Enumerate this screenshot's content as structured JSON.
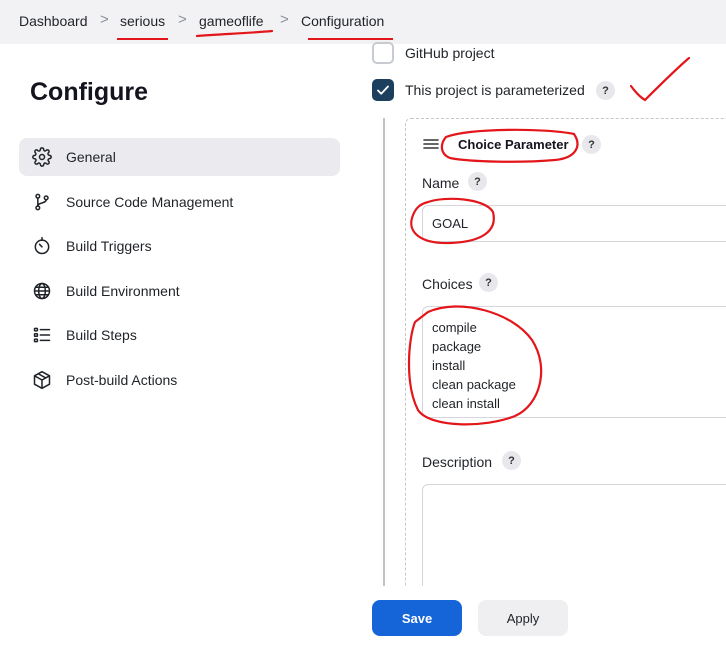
{
  "breadcrumb": {
    "items": [
      "Dashboard",
      "serious",
      "gameoflife",
      "Configuration"
    ],
    "separator": ">"
  },
  "page": {
    "title": "Configure"
  },
  "sidebar": {
    "items": [
      {
        "label": "General",
        "icon": "gear-icon",
        "active": true
      },
      {
        "label": "Source Code Management",
        "icon": "branch-icon"
      },
      {
        "label": "Build Triggers",
        "icon": "timer-icon"
      },
      {
        "label": "Build Environment",
        "icon": "globe-icon"
      },
      {
        "label": "Build Steps",
        "icon": "list-icon"
      },
      {
        "label": "Post-build Actions",
        "icon": "package-icon"
      }
    ]
  },
  "options": {
    "github_project": {
      "label": "GitHub project",
      "checked": false
    },
    "parameterized": {
      "label": "This project is parameterized",
      "checked": true
    }
  },
  "parameter": {
    "title": "Choice Parameter",
    "help": "?",
    "name_label": "Name",
    "name_value": "GOAL",
    "choices_label": "Choices",
    "choices": [
      "compile",
      "package",
      "install",
      "clean package",
      "clean install"
    ],
    "description_label": "Description",
    "description_value": ""
  },
  "actions": {
    "save_label": "Save",
    "apply_label": "Apply"
  },
  "colors": {
    "accent": "#1565d8",
    "checked": "#1d3f5e",
    "annotation": "#e3171b"
  }
}
